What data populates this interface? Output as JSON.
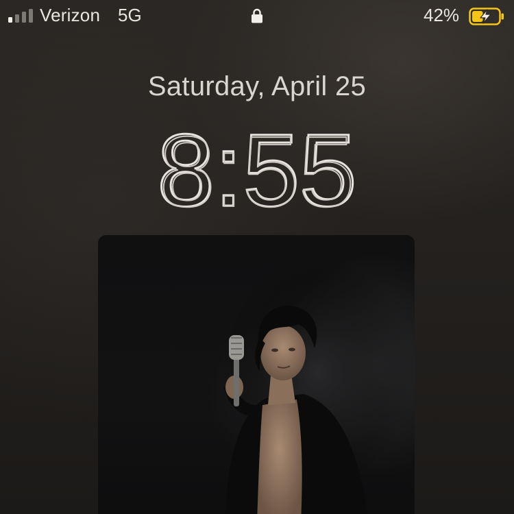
{
  "status_bar": {
    "carrier": "Verizon",
    "network": "5G",
    "signal_bars_active": 1,
    "signal_bars_total": 4,
    "battery_percent": "42%",
    "battery_level": 0.42,
    "battery_charging": true,
    "battery_color": "#f5c518",
    "icons": [
      "signal-icon",
      "lock-icon",
      "battery-charging-icon"
    ]
  },
  "lock_screen": {
    "date": "Saturday, April 25",
    "time": "8:55"
  },
  "photo_widget": {
    "icon": "photo-widget"
  }
}
